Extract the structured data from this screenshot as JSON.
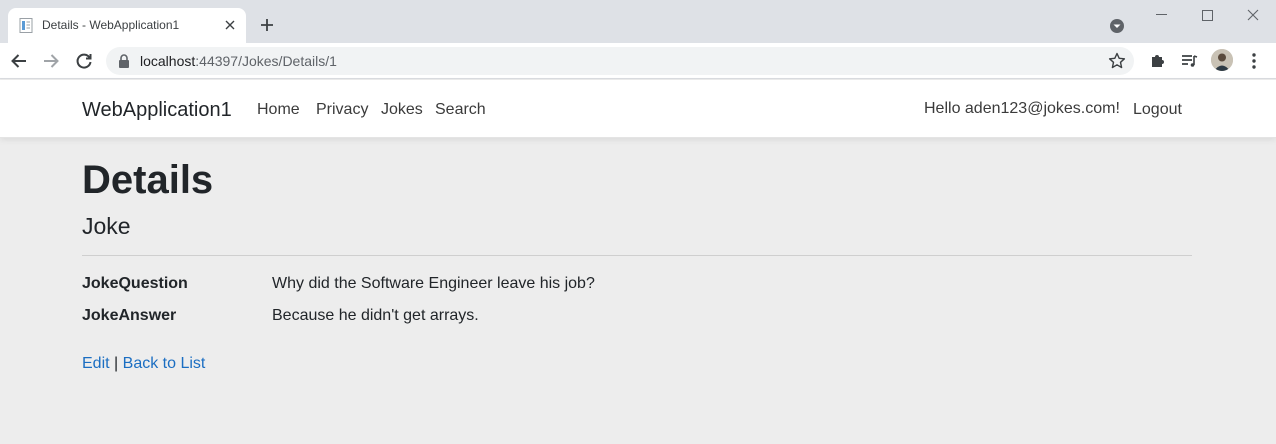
{
  "browser": {
    "tab_title": "Details - WebApplication1",
    "url_host": "localhost",
    "url_path": ":44397/Jokes/Details/1"
  },
  "site": {
    "brand": "WebApplication1",
    "nav": [
      "Home",
      "Privacy",
      "Jokes",
      "Search"
    ],
    "greeting": "Hello aden123@jokes.com!",
    "logout": "Logout"
  },
  "page": {
    "title": "Details",
    "subtitle": "Joke",
    "fields": [
      {
        "label": "JokeQuestion",
        "value": "Why did the Software Engineer leave his job?"
      },
      {
        "label": "JokeAnswer",
        "value": "Because he didn't get arrays."
      }
    ],
    "edit_link": "Edit",
    "separator": "|",
    "back_link": "Back to List"
  },
  "colors": {
    "link": "#1b6ec2",
    "page_background": "#ededed",
    "tabstrip": "#dee1e6"
  },
  "icons": {
    "tab_favicon": "document-icon",
    "tab_close": "close-icon",
    "new_tab": "plus-icon",
    "tab_search": "tab-search-icon",
    "back": "arrow-left-icon",
    "forward": "arrow-right-icon",
    "reload": "reload-icon",
    "lock": "lock-icon",
    "bookmark": "star-icon",
    "extensions": "puzzle-icon",
    "reading_list": "reading-list-icon",
    "menu": "kebab-menu-icon"
  }
}
